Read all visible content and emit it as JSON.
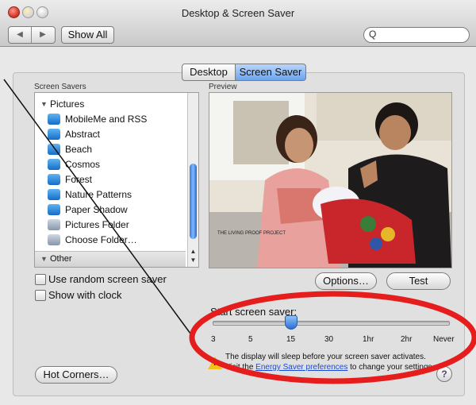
{
  "window": {
    "title": "Desktop & Screen Saver"
  },
  "toolbar": {
    "back_icon": "◀",
    "forward_icon": "▶",
    "show_all": "Show All",
    "search_icon": "search-icon",
    "search_glyph": "Q"
  },
  "tabs": [
    {
      "label": "Desktop"
    },
    {
      "label": "Screen Saver"
    }
  ],
  "screen_savers": {
    "label": "Screen Savers",
    "group_pictures": "Pictures",
    "items": [
      {
        "label": "MobileMe and RSS",
        "icon": "cloud-icon"
      },
      {
        "label": "Abstract",
        "icon": "screensaver-icon"
      },
      {
        "label": "Beach",
        "icon": "screensaver-icon"
      },
      {
        "label": "Cosmos",
        "icon": "screensaver-icon"
      },
      {
        "label": "Forest",
        "icon": "screensaver-icon"
      },
      {
        "label": "Nature Patterns",
        "icon": "screensaver-icon"
      },
      {
        "label": "Paper Shadow",
        "icon": "screensaver-icon"
      },
      {
        "label": "Pictures Folder",
        "icon": "folder-icon"
      },
      {
        "label": "Choose Folder…",
        "icon": "folder-icon"
      }
    ],
    "group_other": "Other"
  },
  "preview": {
    "label": "Preview",
    "watermark": "THE LIVING PROOF PROJECT"
  },
  "options": {
    "use_random": "Use random screen saver",
    "show_clock": "Show with clock",
    "options_button": "Options…",
    "test_button": "Test"
  },
  "start_saver": {
    "label": "Start screen saver:",
    "ticks": [
      "3",
      "5",
      "15",
      "30",
      "1hr",
      "2hr",
      "Never"
    ],
    "selected": "15",
    "warning_line1": "The display will sleep before your screen saver activates.",
    "warning_line2_prefix": "Visit the ",
    "warning_link": "Energy Saver preferences",
    "warning_line2_suffix": " to change your settings."
  },
  "hot_corners": "Hot Corners…",
  "help": "?",
  "colors": {
    "annotation_red": "#e51d1d",
    "selected_tab_blue": "#6aa4ef",
    "link_blue": "#1a4bd6"
  }
}
